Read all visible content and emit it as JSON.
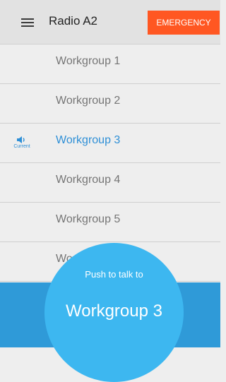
{
  "appbar": {
    "menu_icon": "hamburger-menu-icon",
    "title": "Radio A2",
    "emergency_label": "EMERGENCY",
    "emergency_color": "#ff5722"
  },
  "workgroups": [
    {
      "label": "Workgroup 1",
      "current": false
    },
    {
      "label": "Workgroup 2",
      "current": false
    },
    {
      "label": "Workgroup 3",
      "current": true
    },
    {
      "label": "Workgroup 4",
      "current": false
    },
    {
      "label": "Workgroup 5",
      "current": false
    },
    {
      "label": "Workgroup 6",
      "current": false
    }
  ],
  "current_indicator": {
    "icon": "speaker-icon",
    "label": "Current",
    "color": "#2e8fd6"
  },
  "push_to_talk": {
    "label": "Push to talk to",
    "target": "Workgroup 3",
    "button_color": "#3db7f0",
    "bar_color": "#2f9ad8"
  }
}
